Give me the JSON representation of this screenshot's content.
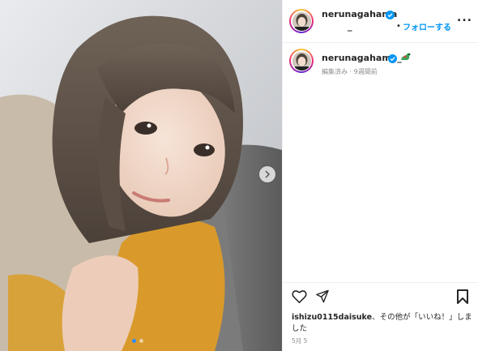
{
  "header": {
    "username_line1": "nerunagahama",
    "username_line2": "_",
    "follow_label": "フォローする",
    "bullet": "•",
    "more_label": "..."
  },
  "caption": {
    "username": "nerunagahama_",
    "emoji_name": "dinosaur-emoji",
    "meta": "編集済み · 9週間前"
  },
  "likes": {
    "user": "ishizu0115daisuke",
    "text": "、その他が「いいね！」しました"
  },
  "date": "5月 5",
  "carousel": {
    "dot_count": 2,
    "active_index": 0
  },
  "colors": {
    "accent": "#0095f6",
    "text": "#262626",
    "muted": "#8e8e8e",
    "verified": "#0095f6"
  },
  "icons": [
    "verified-badge-icon",
    "more-options-icon",
    "heart-icon",
    "share-icon",
    "bookmark-icon",
    "chevron-right-icon"
  ]
}
